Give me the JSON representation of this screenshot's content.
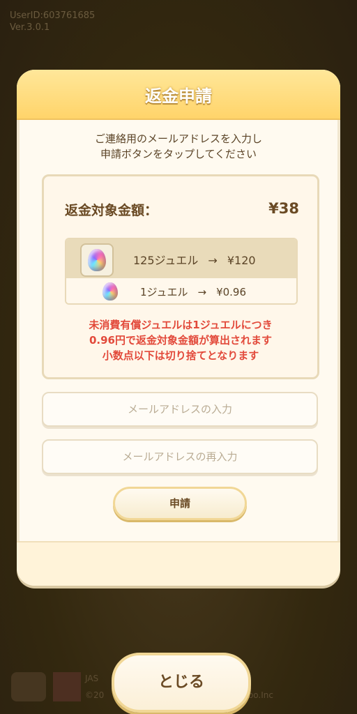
{
  "background": {
    "user_id": "UserID:603761685",
    "version": "Ver.3.0.1",
    "copyright_left": "JAS",
    "copyright_line": "©20",
    "copyright_right": "bo.Inc"
  },
  "modal": {
    "title": "返金申請",
    "instruction": "ご連絡用のメールアドレスを入力し\n申請ボタンをタップしてください",
    "refund_label": "返金対象金額：",
    "refund_amount": "¥38",
    "rates": [
      {
        "gems": "125ジュエル",
        "price": "¥120"
      },
      {
        "gems": "1ジュエル",
        "price": "¥0.96"
      }
    ],
    "notice_lines": [
      "未消費有償ジュエルは1ジュエルにつき",
      "0.96円で返金対象金額が算出されます",
      "小数点以下は切り捨てとなります"
    ],
    "email_placeholder": "メールアドレスの入力",
    "email_confirm_placeholder": "メールアドレスの再入力",
    "apply_label": "申請"
  },
  "close_label": "とじる",
  "colors": {
    "header": "#ffd46a",
    "notice": "#e2493a",
    "text_brown": "#6a4a24"
  }
}
